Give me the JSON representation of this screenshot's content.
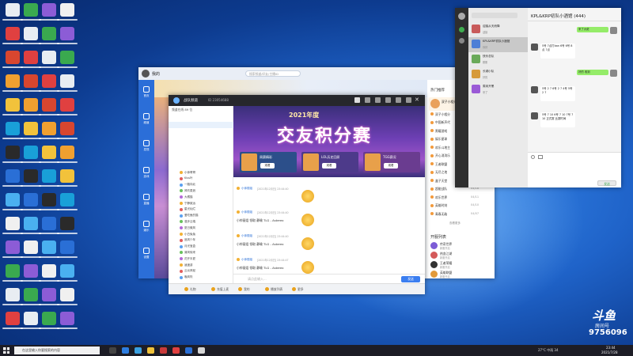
{
  "desktop": {
    "icon_colors": [
      "#e8edf2",
      "#2a6fd6",
      "#d8462f",
      "#f0f0f0",
      "#f2c23b",
      "#3aa94f",
      "#2a2a2a",
      "#e04040",
      "#4ab0f0",
      "#f0a030",
      "#8c5cd6",
      "#19a0d8"
    ]
  },
  "yy_main": {
    "title": "我的",
    "search_placeholder": "搜索频道/好友/主播ID",
    "sidebar_labels": [
      "首页",
      "频道",
      "发现",
      "游戏",
      "直播",
      "娱乐",
      "设置"
    ],
    "promo_text": "双子小相分",
    "promo_badge": "进入",
    "list_title": "热门推荐",
    "list_more": "查看更多",
    "list_items": [
      {
        "name": "双子小相分",
        "count": "06/98"
      },
      {
        "name": "中国新声代",
        "count": "05/18"
      },
      {
        "name": "黑曜游戏",
        "count": "05/41"
      },
      {
        "name": "娱乐星球",
        "count": "05/21"
      },
      {
        "name": "欢乐斗地主",
        "count": "04/39"
      },
      {
        "name": "开心消消乐",
        "count": "04/39"
      },
      {
        "name": "王者联盟",
        "count": "04/31"
      },
      {
        "name": "无尽之地",
        "count": "04/25"
      },
      {
        "name": "盒子天堂",
        "count": "04/18"
      },
      {
        "name": "超能战队",
        "count": "04/18"
      },
      {
        "name": "欢乐世界",
        "count": "04/11"
      },
      {
        "name": "英雄时刻",
        "count": "04/10"
      },
      {
        "name": "青春无敌",
        "count": "04/07"
      }
    ],
    "section_title": "开服列表",
    "game_items": [
      {
        "name": "传奇世界",
        "sub": "新服开启"
      },
      {
        "name": "热血江湖",
        "sub": "新服开启"
      },
      {
        "name": "王者荣耀",
        "sub": "新服开启"
      },
      {
        "name": "英雄联盟",
        "sub": "新服开启"
      }
    ]
  },
  "channel_window": {
    "title": "战队频道",
    "channel_id": "ID 23054688",
    "banner_title": "交友积分赛",
    "banner_year": "2021年度",
    "banner_tiles": [
      {
        "label": "周赛精彩",
        "btn": "观看"
      },
      {
        "label": "LOL历史回顾",
        "btn": "观看"
      },
      {
        "label": "TGG赛况",
        "btn": "观看"
      }
    ],
    "member_header": "频道在线 89 位",
    "members": [
      "小帅哥哥",
      "Kiss叶",
      "一路向北",
      "风吹麦浪",
      "大橘猫",
      "宁静致远",
      "星光灿烂",
      "爱吃鱼的猫",
      "漫步云端",
      "夏日微风",
      "小白兔兔",
      "追风少年",
      "月光宝盒",
      "清风徐来",
      "花开半夏",
      "逍遥游",
      "云淡风轻",
      "晚风吹"
    ],
    "messages": [
      {
        "name": "小帅丽姐",
        "time": "[2021年12月日] 23:44:40",
        "text": ""
      },
      {
        "name": "小帅丽姐",
        "time": "[2021年12月日] 23:44:40",
        "text": "小帅丽姐 领取 静瑜 TLG - Asterex"
      },
      {
        "name": "小帅丽姐",
        "time": "[2021年12月日] 23:44:40",
        "text": "小帅丽姐 领取 静瑜 TLG - Asterex"
      },
      {
        "name": "小帅丽姐",
        "time": "[2021年12月日] 23:44:47",
        "text": "小帅丽姐 领取 静瑜 TLG - Asterex"
      }
    ],
    "input_placeholder": "请点此输入...",
    "bottom_bar": [
      "礼物",
      "充值上麦",
      "我的",
      "播放列表",
      "更多"
    ],
    "send_label": "发送"
  },
  "chat_window": {
    "title": "KPL&KRP初队小酒馆 (444)",
    "conversations": [
      {
        "name": "迎接从天而降",
        "preview": "迎接"
      },
      {
        "name": "KPL&KRP初队小酒馆",
        "preview": "你好"
      },
      {
        "name": "快乐总队",
        "preview": "刚刚"
      },
      {
        "name": "长城小队",
        "preview": "好的"
      },
      {
        "name": "周末开黑",
        "preview": "来了"
      }
    ],
    "messages": [
      {
        "side": "right",
        "text": "来了大佬"
      },
      {
        "side": "left",
        "text": "5号 7点打ban 6号 6号 8点 7点"
      },
      {
        "side": "right",
        "text": "好的 收到"
      },
      {
        "side": "left",
        "text": "5号 2 7 6号 2 7 4号 5号 2 7"
      },
      {
        "side": "left",
        "text": "5号 7 10 6号 7 10 7号 7 10 正式赛 比赛时间"
      }
    ],
    "send_label": "发送"
  },
  "douyu": {
    "logo": "斗鱼",
    "sub": "房间号",
    "room_id": "9756096"
  },
  "taskbar": {
    "search_placeholder": "在这里输入你要搜索的内容",
    "weather": "27°C 中雨 34",
    "time": "23:44",
    "date": "2021/7/28"
  }
}
